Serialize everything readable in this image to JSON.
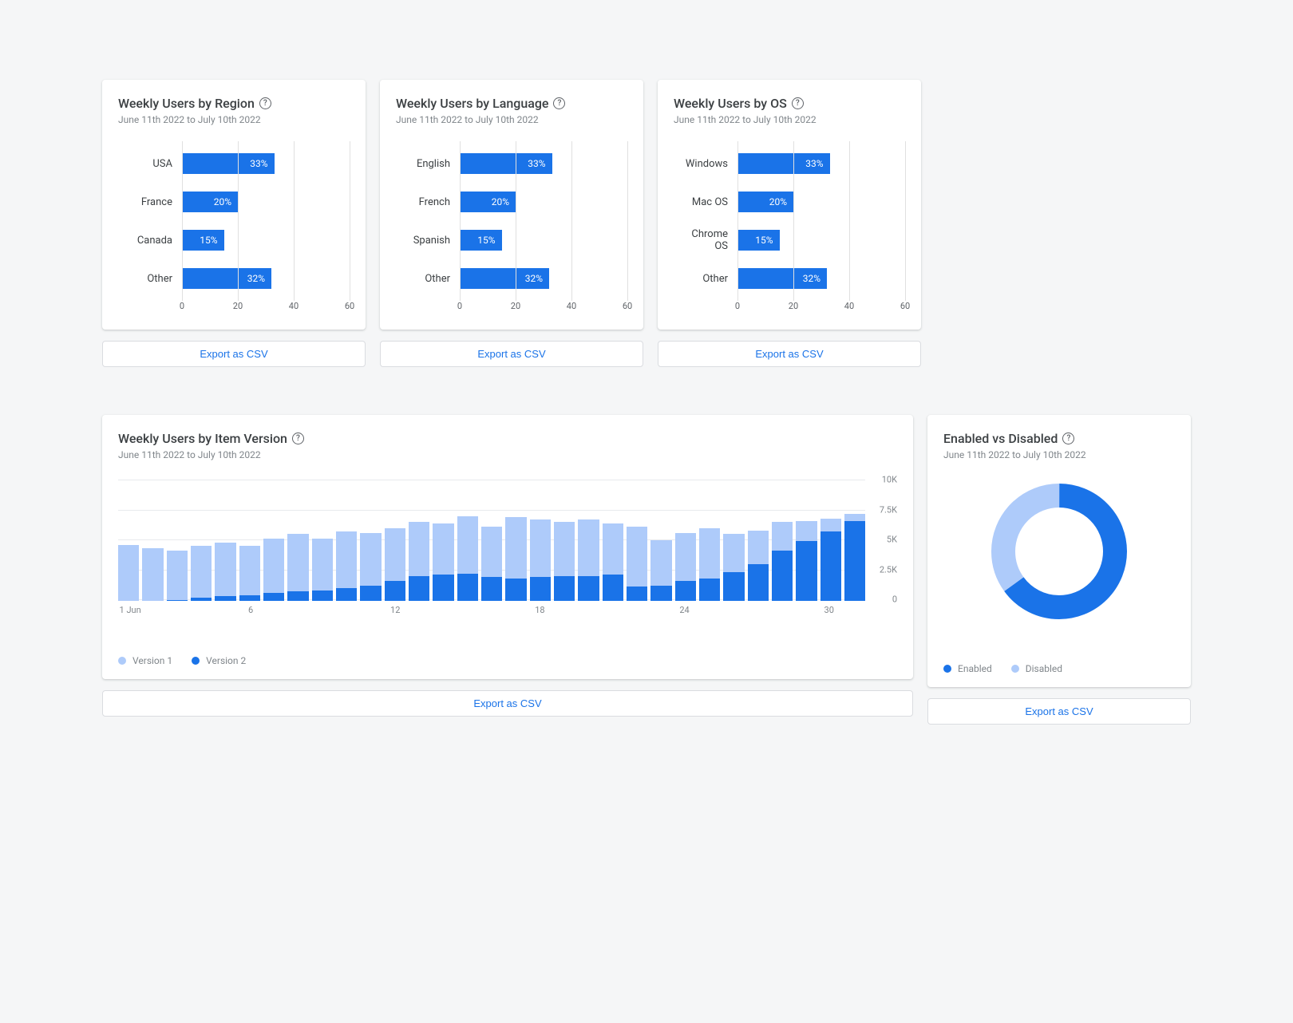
{
  "date_range": "June 11th 2022 to July 10th 2022",
  "export_label": "Export as CSV",
  "cards": {
    "region": {
      "title": "Weekly Users by Region"
    },
    "language": {
      "title": "Weekly Users by Language"
    },
    "os": {
      "title": "Weekly Users by OS"
    },
    "version": {
      "title": "Weekly Users by Item Version"
    },
    "enabled": {
      "title": "Enabled vs Disabled"
    }
  },
  "legend": {
    "v1": "Version 1",
    "v2": "Version 2",
    "enabled": "Enabled",
    "disabled": "Disabled"
  },
  "chart_data": [
    {
      "id": "region",
      "type": "bar",
      "orientation": "horizontal",
      "categories": [
        "USA",
        "France",
        "Canada",
        "Other"
      ],
      "values": [
        33,
        20,
        15,
        32
      ],
      "value_suffix": "%",
      "x_ticks": [
        0,
        20,
        40,
        60
      ],
      "xlim": [
        0,
        60
      ]
    },
    {
      "id": "language",
      "type": "bar",
      "orientation": "horizontal",
      "categories": [
        "English",
        "French",
        "Spanish",
        "Other"
      ],
      "values": [
        33,
        20,
        15,
        32
      ],
      "value_suffix": "%",
      "x_ticks": [
        0,
        20,
        40,
        60
      ],
      "xlim": [
        0,
        60
      ]
    },
    {
      "id": "os",
      "type": "bar",
      "orientation": "horizontal",
      "categories": [
        "Windows",
        "Mac OS",
        "Chrome OS",
        "Other"
      ],
      "values": [
        33,
        20,
        15,
        32
      ],
      "value_suffix": "%",
      "x_ticks": [
        0,
        20,
        40,
        60
      ],
      "xlim": [
        0,
        60
      ]
    },
    {
      "id": "version",
      "type": "bar",
      "orientation": "vertical",
      "stacked": true,
      "x": [
        1,
        2,
        3,
        4,
        5,
        6,
        7,
        8,
        9,
        10,
        11,
        12,
        13,
        14,
        15,
        16,
        17,
        18,
        19,
        20,
        21,
        22,
        23,
        24,
        25,
        26,
        27,
        28,
        29,
        30,
        31
      ],
      "x_tick_labels": {
        "1": "1 Jun",
        "6": "6",
        "12": "12",
        "18": "18",
        "24": "24",
        "30": "30"
      },
      "series": [
        {
          "name": "Version 1",
          "color": "#aecbfa",
          "values": [
            4700,
            4400,
            4100,
            4300,
            4500,
            4100,
            4500,
            4800,
            4300,
            4700,
            4400,
            4400,
            4500,
            4300,
            4800,
            4200,
            5100,
            4800,
            4500,
            4700,
            4300,
            5000,
            3800,
            4000,
            4200,
            3200,
            2800,
            2400,
            1700,
            1100,
            600
          ]
        },
        {
          "name": "Version 2",
          "color": "#1a73e8",
          "values": [
            0,
            0,
            100,
            300,
            400,
            500,
            700,
            800,
            900,
            1100,
            1300,
            1700,
            2100,
            2200,
            2300,
            2000,
            1900,
            2000,
            2100,
            2100,
            2200,
            1200,
            1300,
            1700,
            1900,
            2400,
            3100,
            4200,
            5000,
            5800,
            6700
          ]
        }
      ],
      "y_ticks": [
        0,
        2500,
        5000,
        7500,
        10000
      ],
      "y_tick_labels": [
        "0",
        "2.5K",
        "5K",
        "7.5K",
        "10K"
      ],
      "ylim": [
        0,
        10000
      ]
    },
    {
      "id": "enabled",
      "type": "pie",
      "donut": true,
      "categories": [
        "Enabled",
        "Disabled"
      ],
      "values": [
        65,
        35
      ],
      "colors": [
        "#1a73e8",
        "#aecbfa"
      ]
    }
  ]
}
